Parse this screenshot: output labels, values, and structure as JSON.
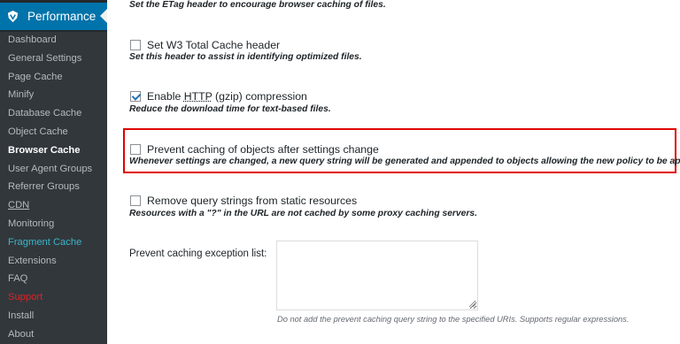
{
  "sidebar": {
    "header_label": "Performance",
    "header_icon": "w3tc-performance-icon",
    "items": [
      {
        "label": "Dashboard",
        "color": "#b4b9be",
        "current": false
      },
      {
        "label": "General Settings",
        "color": "#b4b9be",
        "current": false
      },
      {
        "label": "Page Cache",
        "color": "#b4b9be",
        "current": false
      },
      {
        "label": "Minify",
        "color": "#b4b9be",
        "current": false
      },
      {
        "label": "Database Cache",
        "color": "#b4b9be",
        "current": false
      },
      {
        "label": "Object Cache",
        "color": "#b4b9be",
        "current": false
      },
      {
        "label": "Browser Cache",
        "color": "#ffffff",
        "current": true
      },
      {
        "label": "User Agent Groups",
        "color": "#b4b9be",
        "current": false
      },
      {
        "label": "Referrer Groups",
        "color": "#b4b9be",
        "current": false
      },
      {
        "label": "CDN",
        "color": "#b4b9be",
        "current": false
      },
      {
        "label": "Monitoring",
        "color": "#b4b9be",
        "current": false
      },
      {
        "label": "Fragment Cache",
        "color": "#3ab6c8",
        "current": false
      },
      {
        "label": "Extensions",
        "color": "#b4b9be",
        "current": false
      },
      {
        "label": "FAQ",
        "color": "#b4b9be",
        "current": false
      },
      {
        "label": "Support",
        "color": "#e62020",
        "current": false
      },
      {
        "label": "Install",
        "color": "#b4b9be",
        "current": false
      },
      {
        "label": "About",
        "color": "#b4b9be",
        "current": false
      }
    ]
  },
  "main": {
    "etag_description": "Set the ETag header to encourage browser caching of files.",
    "options": [
      {
        "label_pre": "Set W3 Total Cache header",
        "label_abbr": "",
        "label_post": "",
        "checked": false,
        "description": "Set this header to assist in identifying optimized files."
      },
      {
        "label_pre": "Enable ",
        "label_abbr": "HTTP",
        "label_post": " (gzip) compression",
        "checked": true,
        "description": "Reduce the download time for text-based files."
      },
      {
        "label_pre": "Prevent caching of objects after settings change",
        "label_abbr": "",
        "label_post": "",
        "checked": false,
        "description": "Whenever settings are changed, a new query string will be generated and appended to objects allowing the new policy to be applied."
      },
      {
        "label_pre": "Remove query strings from static resources",
        "label_abbr": "",
        "label_post": "",
        "checked": false,
        "description": "Resources with a \"?\" in the URL are not cached by some proxy caching servers."
      }
    ],
    "exception": {
      "label": "Prevent caching exception list:",
      "value": "",
      "hint": "Do not add the prevent caching query string to the specified URIs. Supports regular expressions."
    },
    "highlight_color": "#e00000"
  }
}
